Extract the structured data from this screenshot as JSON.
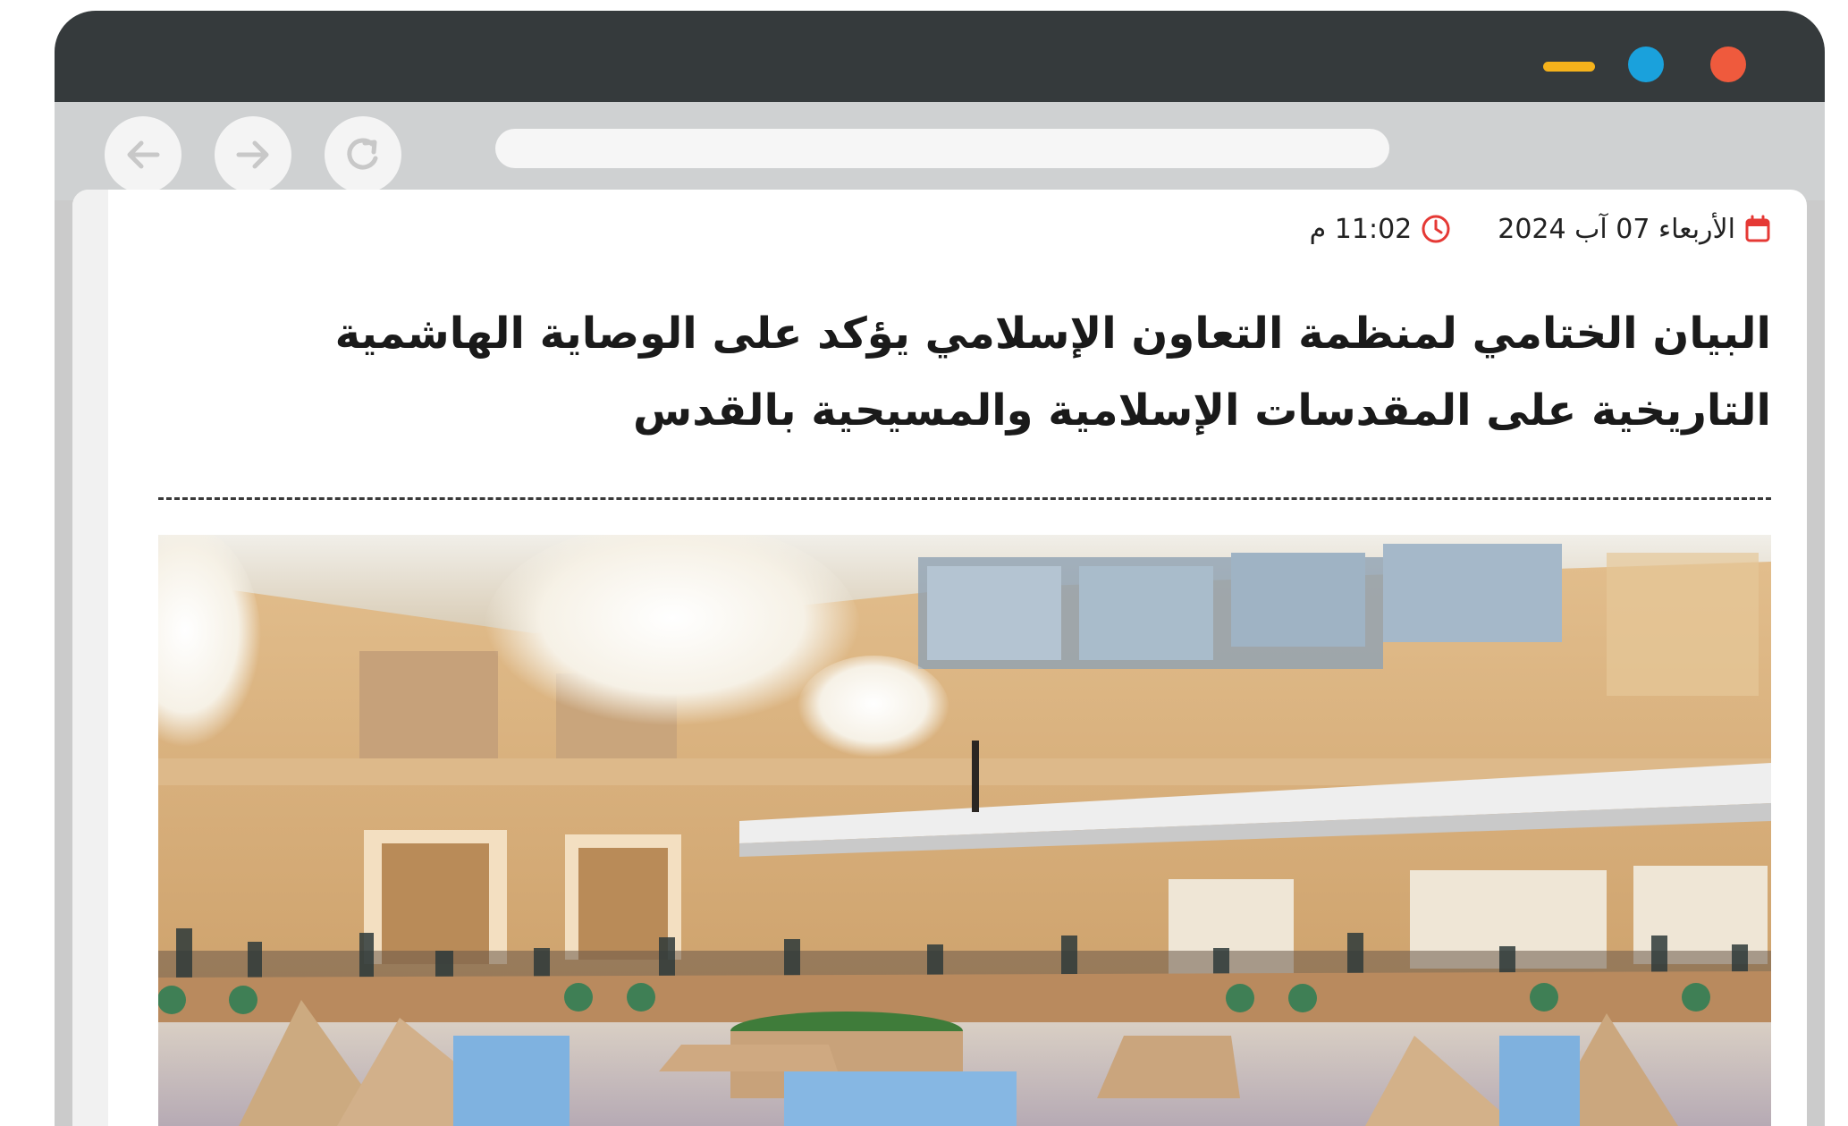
{
  "article": {
    "date": "الأربعاء 07 آب 2024",
    "time": "11:02 م",
    "title": "البيان الختامي لمنظمة التعاون الإسلامي يؤكد على الوصاية الهاشمية التاريخية على المقدسات الإسلامية والمسيحية بالقدس"
  },
  "colors": {
    "titlebar": "#353a3c",
    "minimize": "#f5b21b",
    "maximize": "#1aa1dc",
    "close": "#ef5a3d",
    "meta_icon": "#e53935"
  },
  "icons": {
    "date": "calendar-icon",
    "time": "clock-icon",
    "back": "arrow-left-icon",
    "forward": "arrow-right-icon",
    "reload": "reload-icon"
  }
}
